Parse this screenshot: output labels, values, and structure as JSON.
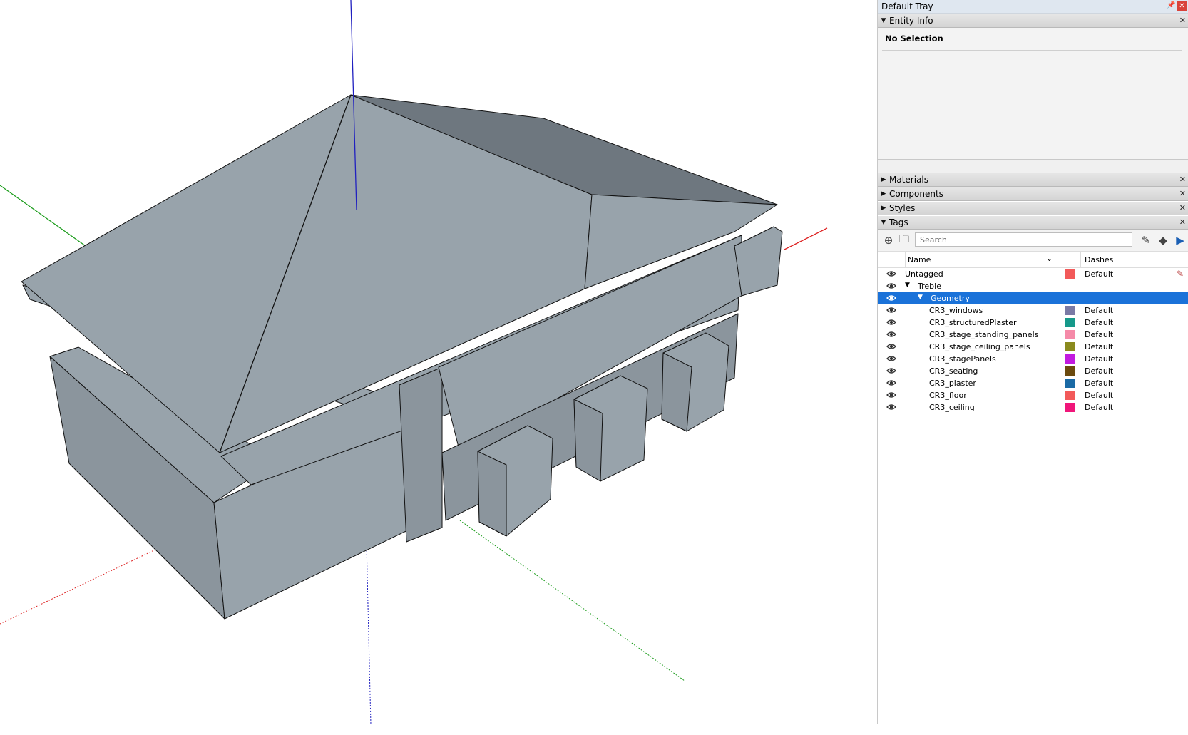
{
  "tray": {
    "title": "Default Tray",
    "pin_icon": "pin-icon",
    "close_icon": "close-icon"
  },
  "entity_info": {
    "label": "Entity Info",
    "expanded": true,
    "message": "No Selection"
  },
  "panels": [
    {
      "label": "Materials",
      "expanded": false
    },
    {
      "label": "Components",
      "expanded": false
    },
    {
      "label": "Styles",
      "expanded": false
    },
    {
      "label": "Tags",
      "expanded": true
    }
  ],
  "tags": {
    "search_placeholder": "Search",
    "columns": {
      "name": "Name",
      "dashes": "Dashes"
    },
    "rows": [
      {
        "name": "Untagged",
        "level": 0,
        "folder": false,
        "color": "#f25a5a",
        "dashes": "Default",
        "visible": true,
        "selected": false,
        "edit_icon": "pencil-icon"
      },
      {
        "name": "Treble",
        "level": 0,
        "folder": true,
        "color": "",
        "dashes": "",
        "visible": true,
        "selected": false
      },
      {
        "name": "Geometry",
        "level": 1,
        "folder": true,
        "color": "",
        "dashes": "",
        "visible": true,
        "selected": true
      },
      {
        "name": "CR3_windows",
        "level": 2,
        "folder": false,
        "color": "#7a7aa5",
        "dashes": "Default",
        "visible": true,
        "selected": false
      },
      {
        "name": "CR3_structuredPlaster",
        "level": 2,
        "folder": false,
        "color": "#16998a",
        "dashes": "Default",
        "visible": true,
        "selected": false
      },
      {
        "name": "CR3_stage_standing_panels",
        "level": 2,
        "folder": false,
        "color": "#f58aa8",
        "dashes": "Default",
        "visible": true,
        "selected": false
      },
      {
        "name": "CR3_stage_ceiling_panels",
        "level": 2,
        "folder": false,
        "color": "#8a8a1e",
        "dashes": "Default",
        "visible": true,
        "selected": false
      },
      {
        "name": "CR3_stagePanels",
        "level": 2,
        "folder": false,
        "color": "#c21ae0",
        "dashes": "Default",
        "visible": true,
        "selected": false
      },
      {
        "name": "CR3_seating",
        "level": 2,
        "folder": false,
        "color": "#6b4a0e",
        "dashes": "Default",
        "visible": true,
        "selected": false
      },
      {
        "name": "CR3_plaster",
        "level": 2,
        "folder": false,
        "color": "#1a6aa5",
        "dashes": "Default",
        "visible": true,
        "selected": false
      },
      {
        "name": "CR3_floor",
        "level": 2,
        "folder": false,
        "color": "#f25a5a",
        "dashes": "Default",
        "visible": true,
        "selected": false
      },
      {
        "name": "CR3_ceiling",
        "level": 2,
        "folder": false,
        "color": "#f0167a",
        "dashes": "Default",
        "visible": true,
        "selected": false
      }
    ]
  },
  "colors": {
    "face_light": "#98a3ab",
    "face_dark": "#6e777f",
    "face_mid": "#8b959d",
    "selection": "#1a72d9",
    "axis_red": "#d22",
    "axis_green": "#1b9c1b",
    "axis_blue": "#2020c0"
  }
}
